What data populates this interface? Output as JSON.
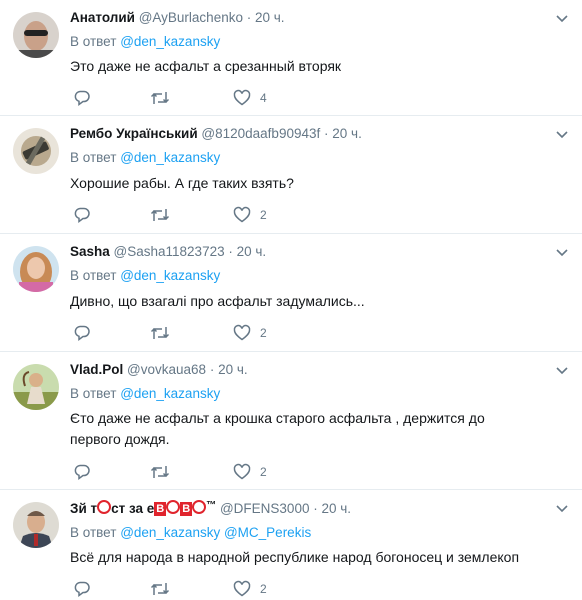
{
  "common": {
    "reply_prefix": "В ответ",
    "dot": "·",
    "colors": {
      "link": "#1da1f2",
      "muted": "#657786",
      "text": "#14171a",
      "divider": "#e6ecf0"
    },
    "icons": [
      "reply-icon",
      "retweet-icon",
      "heart-icon",
      "chevron-down-icon"
    ]
  },
  "tweets": [
    {
      "name": "Анатолий",
      "handle": "@AyBurlachenko",
      "time": "20 ч.",
      "reply_to": [
        "@den_kazansky"
      ],
      "text": "Это даже не асфальт а срезанный вторяк",
      "likes": "4"
    },
    {
      "name": "Рембо Український",
      "handle": "@8120daafb90943f",
      "time": "20 ч.",
      "reply_to": [
        "@den_kazansky"
      ],
      "text": "Хорошие рабы. А где таких взять?",
      "likes": "2"
    },
    {
      "name": "Sasha",
      "handle": "@Sasha11823723",
      "time": "20 ч.",
      "reply_to": [
        "@den_kazansky"
      ],
      "text": "Дивно, що взагалі про асфальт задумались...",
      "likes": "2"
    },
    {
      "name": "Vlad.Pol",
      "handle": "@vovkaua68",
      "time": "20 ч.",
      "reply_to": [
        "@den_kazansky"
      ],
      "text": "Єто даже не асфальт а крошка старого асфальта , держится до первого дождя.",
      "likes": "2"
    },
    {
      "name_parts": [
        "Зй т",
        "ст за е",
        "В",
        "В",
        "™"
      ],
      "handle": "@DFENS3000",
      "time": "20 ч.",
      "reply_to": [
        "@den_kazansky",
        "@MC_Perekis"
      ],
      "text": "Всё для народа в народной республике народ богоносец и землекоп",
      "likes": "2"
    }
  ]
}
